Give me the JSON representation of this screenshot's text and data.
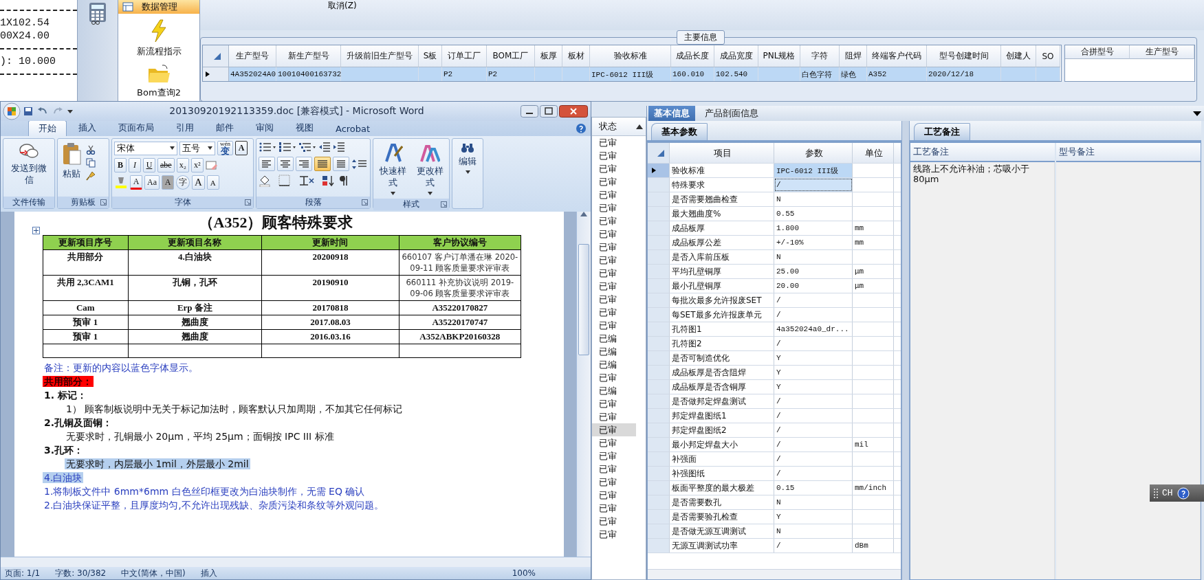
{
  "background_text": {
    "lines": [
      "1X102.54",
      "00X24.00",
      "): 10.000"
    ]
  },
  "nav": {
    "header": "数据管理",
    "items": [
      {
        "label": "新流程指示",
        "kind": "process"
      },
      {
        "label": "Bom查询2",
        "kind": "query"
      }
    ]
  },
  "toolbar": {
    "cancel_button": "取消(Z)"
  },
  "main_info": {
    "title": "主要信息",
    "columns": [
      "生产型号",
      "新生产型号",
      "升级前旧生产型号",
      "S板",
      "订单工厂",
      "BOM工厂",
      "板厚",
      "板材",
      "验收标准",
      "成品长度",
      "成品宽度",
      "PNL规格",
      "字符",
      "阻焊",
      "终端客户代码",
      "型号创建时间",
      "创建人",
      "SO"
    ],
    "rows": [
      {
        "selected": true,
        "cells": [
          "4A352024A0",
          "10010400163732",
          null,
          null,
          "P2",
          "P2",
          null,
          null,
          "IPC-6012 III级",
          "160.010",
          "102.540",
          null,
          "白色字符",
          "绿色",
          "A352",
          "2020/12/18",
          null,
          null
        ]
      }
    ]
  },
  "merge_table": {
    "columns": [
      "合拼型号",
      "生产型号"
    ]
  },
  "status_list": {
    "header": "状态",
    "items": [
      {
        "label": "已审",
        "selected": false
      },
      {
        "label": "已审",
        "selected": false
      },
      {
        "label": "已审",
        "selected": false
      },
      {
        "label": "已审",
        "selected": false
      },
      {
        "label": "已审",
        "selected": false
      },
      {
        "label": "已审",
        "selected": false
      },
      {
        "label": "已审",
        "selected": false
      },
      {
        "label": "已审",
        "selected": false
      },
      {
        "label": "已审",
        "selected": false
      },
      {
        "label": "已审",
        "selected": false
      },
      {
        "label": "已审",
        "selected": false
      },
      {
        "label": "已审",
        "selected": false
      },
      {
        "label": "已审",
        "selected": false
      },
      {
        "label": "已审",
        "selected": false
      },
      {
        "label": "已审",
        "selected": false
      },
      {
        "label": "已编",
        "selected": false
      },
      {
        "label": "已编",
        "selected": false
      },
      {
        "label": "已编",
        "selected": false
      },
      {
        "label": "已审",
        "selected": false
      },
      {
        "label": "已编",
        "selected": false
      },
      {
        "label": "已审",
        "selected": false
      },
      {
        "label": "已审",
        "selected": false
      },
      {
        "label": "已审",
        "selected": true
      },
      {
        "label": "已审",
        "selected": false
      },
      {
        "label": "已审",
        "selected": false
      },
      {
        "label": "已审",
        "selected": false
      },
      {
        "label": "已审",
        "selected": false
      },
      {
        "label": "已审",
        "selected": false
      },
      {
        "label": "已审",
        "selected": false
      },
      {
        "label": "已审",
        "selected": false
      },
      {
        "label": "已审",
        "selected": false
      }
    ]
  },
  "detail_tabs": [
    {
      "label": "基本信息",
      "selected": true
    },
    {
      "label": "产品剖面信息",
      "selected": false
    }
  ],
  "params": {
    "tab": "基本参数",
    "columns": [
      "项目",
      "参数",
      "单位"
    ],
    "rows": [
      {
        "item": "验收标准",
        "value": "IPC-6012 III级",
        "selected": true,
        "focused": false
      },
      {
        "item": "特殊要求",
        "value": "/",
        "selected": false,
        "focused": true
      },
      {
        "item": "是否需要翘曲检查",
        "value": "N",
        "selected": false,
        "focused": false
      },
      {
        "item": "最大翘曲度%",
        "value": "0.55",
        "selected": false,
        "focused": false
      },
      {
        "item": "成品板厚",
        "value": "1.800",
        "unit": "mm",
        "selected": false,
        "focused": false
      },
      {
        "item": "成品板厚公差",
        "value": "+/-10%",
        "unit": "mm",
        "selected": false,
        "focused": false
      },
      {
        "item": "是否入库前压板",
        "value": "N",
        "selected": false,
        "focused": false
      },
      {
        "item": "平均孔壁铜厚",
        "value": "25.00",
        "unit": "μm",
        "selected": false,
        "focused": false
      },
      {
        "item": "最小孔壁铜厚",
        "value": "20.00",
        "unit": "μm",
        "selected": false,
        "focused": false
      },
      {
        "item": "每批次最多允许报废SET",
        "value": "/",
        "selected": false,
        "focused": false
      },
      {
        "item": "每SET最多允许报废单元",
        "value": "/",
        "selected": false,
        "focused": false
      },
      {
        "item": "孔符图1",
        "value": "4a352024a0_dr...",
        "selected": false,
        "focused": false
      },
      {
        "item": "孔符图2",
        "value": "/",
        "selected": false,
        "focused": false
      },
      {
        "item": "是否可制造优化",
        "value": "Y",
        "selected": false,
        "focused": false
      },
      {
        "item": "成品板厚是否含阻焊",
        "value": "Y",
        "selected": false,
        "focused": false
      },
      {
        "item": "成品板厚是否含铜厚",
        "value": "Y",
        "selected": false,
        "focused": false
      },
      {
        "item": "是否做邦定焊盘测试",
        "value": "/",
        "selected": false,
        "focused": false
      },
      {
        "item": "邦定焊盘图纸1",
        "value": "/",
        "selected": false,
        "focused": false
      },
      {
        "item": "邦定焊盘图纸2",
        "value": "/",
        "selected": false,
        "focused": false
      },
      {
        "item": "最小邦定焊盘大小",
        "value": "/",
        "unit": "mil",
        "selected": false,
        "focused": false
      },
      {
        "item": "补强面",
        "value": "/",
        "selected": false,
        "focused": false
      },
      {
        "item": "补强图纸",
        "value": "/",
        "selected": false,
        "focused": false
      },
      {
        "item": "板面平整度的最大极差",
        "value": "0.15",
        "unit": "mm/inch",
        "selected": false,
        "focused": false
      },
      {
        "item": "是否需要数孔",
        "value": "N",
        "selected": false,
        "focused": false
      },
      {
        "item": "是否需要验孔检查",
        "value": "Y",
        "selected": false,
        "focused": false
      },
      {
        "item": "是否做无源互调测试",
        "value": "N",
        "selected": false,
        "focused": false
      },
      {
        "item": "无源互调测试功率",
        "value": "/",
        "unit": "dBm",
        "selected": false,
        "focused": false
      }
    ]
  },
  "notes": {
    "tab": "工艺备注",
    "columns": [
      {
        "header": "工艺备注",
        "text": "线路上不允许补油；芯吸小于80μm"
      },
      {
        "header": "型号备注"
      }
    ]
  },
  "ime": {
    "label": "CH"
  },
  "word": {
    "title": "20130920192113359.doc [兼容模式] - Microsoft Word",
    "tabs": [
      {
        "label": "开始",
        "selected": true
      },
      {
        "label": "插入",
        "selected": false
      },
      {
        "label": "页面布局",
        "selected": false
      },
      {
        "label": "引用",
        "selected": false
      },
      {
        "label": "邮件",
        "selected": false
      },
      {
        "label": "审阅",
        "selected": false
      },
      {
        "label": "视图",
        "selected": false
      },
      {
        "label": "Acrobat",
        "selected": false
      }
    ],
    "ribbon": {
      "file_group": "文件传输",
      "send_button": "发送到微信",
      "clipboard_group": "剪贴板",
      "paste_button": "粘贴",
      "font_group": "字体",
      "font": "宋体",
      "size": "五号",
      "phonetic": "wén",
      "phonetic_base": "变",
      "border_letter": "A",
      "format_buttons": [
        "B",
        "I",
        "U",
        "abe",
        "x₂",
        "x²"
      ],
      "color_buttons": [
        "A",
        "Aa",
        "A",
        "字",
        "A",
        "A"
      ],
      "paragraph_group": "段落",
      "alignment": [
        {
          "kind": "left",
          "selected": false
        },
        {
          "kind": "center",
          "selected": false
        },
        {
          "kind": "right",
          "selected": false
        },
        {
          "kind": "justify",
          "selected": true
        },
        {
          "kind": "distributed",
          "selected": false
        }
      ],
      "styles_group": "样式",
      "style_buttons": [
        "快速样式",
        "更改样式"
      ],
      "edit_button": "编辑"
    },
    "document": {
      "title": "（A352）顾客特殊要求",
      "table": {
        "columns": [
          "更新项目序号",
          "更新项目名称",
          "更新时间",
          "客户协议编号"
        ],
        "rows": [
          {
            "kind": "note",
            "cells": [
              "共用部分",
              "4.白油块",
              "20200918",
              "660107 客户订单潘在琳 2020-09-11 顾客质量要求评审表"
            ]
          },
          {
            "kind": "note",
            "cells": [
              "共用 2,3CAM1",
              "孔铜，孔环",
              "20190910",
              "660111 补充协议说明 2019-09-06 顾客质量要求评审表"
            ]
          },
          {
            "kind": "code",
            "cells": [
              "Cam",
              "Erp 备注",
              "20170818",
              "A35220170827"
            ]
          },
          {
            "kind": "code",
            "cells": [
              "预审 1",
              "翘曲度",
              "2017.08.03",
              "A35220170747"
            ]
          },
          {
            "kind": "code",
            "cells": [
              "预审 1",
              "翘曲度",
              "2016.03.16",
              "A352ABKP20160328"
            ]
          },
          {
            "kind": "blank"
          }
        ]
      },
      "paragraphs": [
        {
          "kind": "note",
          "text": "备注：更新的内容以蓝色字体显示。",
          "selected": false
        },
        {
          "kind": "alert",
          "text": "共用部分：",
          "selected": false
        },
        {
          "kind": "heading",
          "text": "1.   标记：",
          "selected": false
        },
        {
          "kind": "body",
          "text": "1） 顾客制板说明中无关于标记加法时，顾客默认只加周期，不加其它任何标记",
          "selected": false
        },
        {
          "kind": "heading",
          "text": "2.孔铜及面铜：",
          "selected": false
        },
        {
          "kind": "body",
          "text": "无要求时，孔铜最小 20μm，平均 25μm；面铜按 IPC III 标准",
          "selected": false
        },
        {
          "kind": "heading",
          "text": "3.孔环：",
          "selected": false
        },
        {
          "kind": "body",
          "text": "无要求时，内层最小 1mil，外层最小 2mil",
          "selected": true
        },
        {
          "kind": "note",
          "text": "4.白油块",
          "selected": true
        },
        {
          "kind": "note",
          "text": "1.将制板文件中 6mm*6mm 白色丝印框更改为白油块制作，无需 EQ 确认",
          "selected": false
        },
        {
          "kind": "note",
          "text": "2.白油块保证平整，且厚度均匀,不允许出现残缺、杂质污染和条纹等外观问题。",
          "selected": false
        }
      ]
    },
    "status_bar": [
      "页面: 1/1",
      "字数: 30/382",
      "中文(简体，中国)",
      "插入",
      "100%"
    ]
  }
}
